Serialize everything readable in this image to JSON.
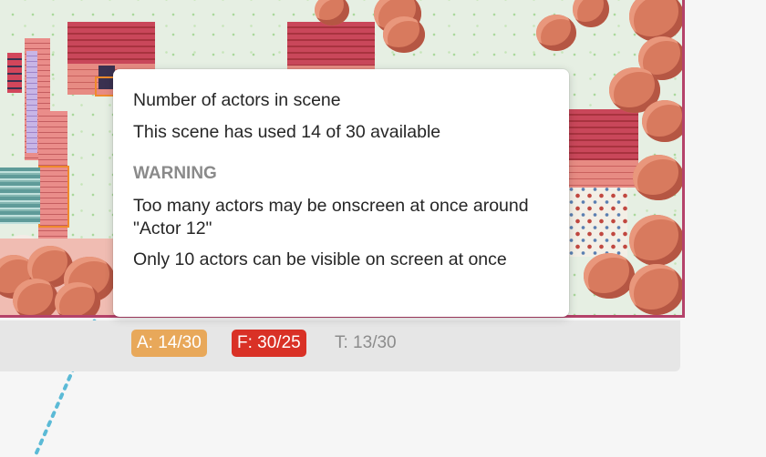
{
  "tooltip": {
    "title": "Number of actors in scene",
    "usage": "This scene has used 14 of 30 available",
    "warning_heading": "WARNING",
    "warning_onscreen": "Too many actors may be onscreen at once around \"Actor 12\"",
    "warning_limit": "Only 10 actors can be visible on screen at once"
  },
  "status": {
    "actors": "A: 14/30",
    "frames": "F: 30/25",
    "triggers": "T: 13/30"
  },
  "colors": {
    "actors_badge": "#e8a85a",
    "frames_badge": "#d93126",
    "scene_border": "#b4426a",
    "connection_line": "#5bbad6"
  }
}
